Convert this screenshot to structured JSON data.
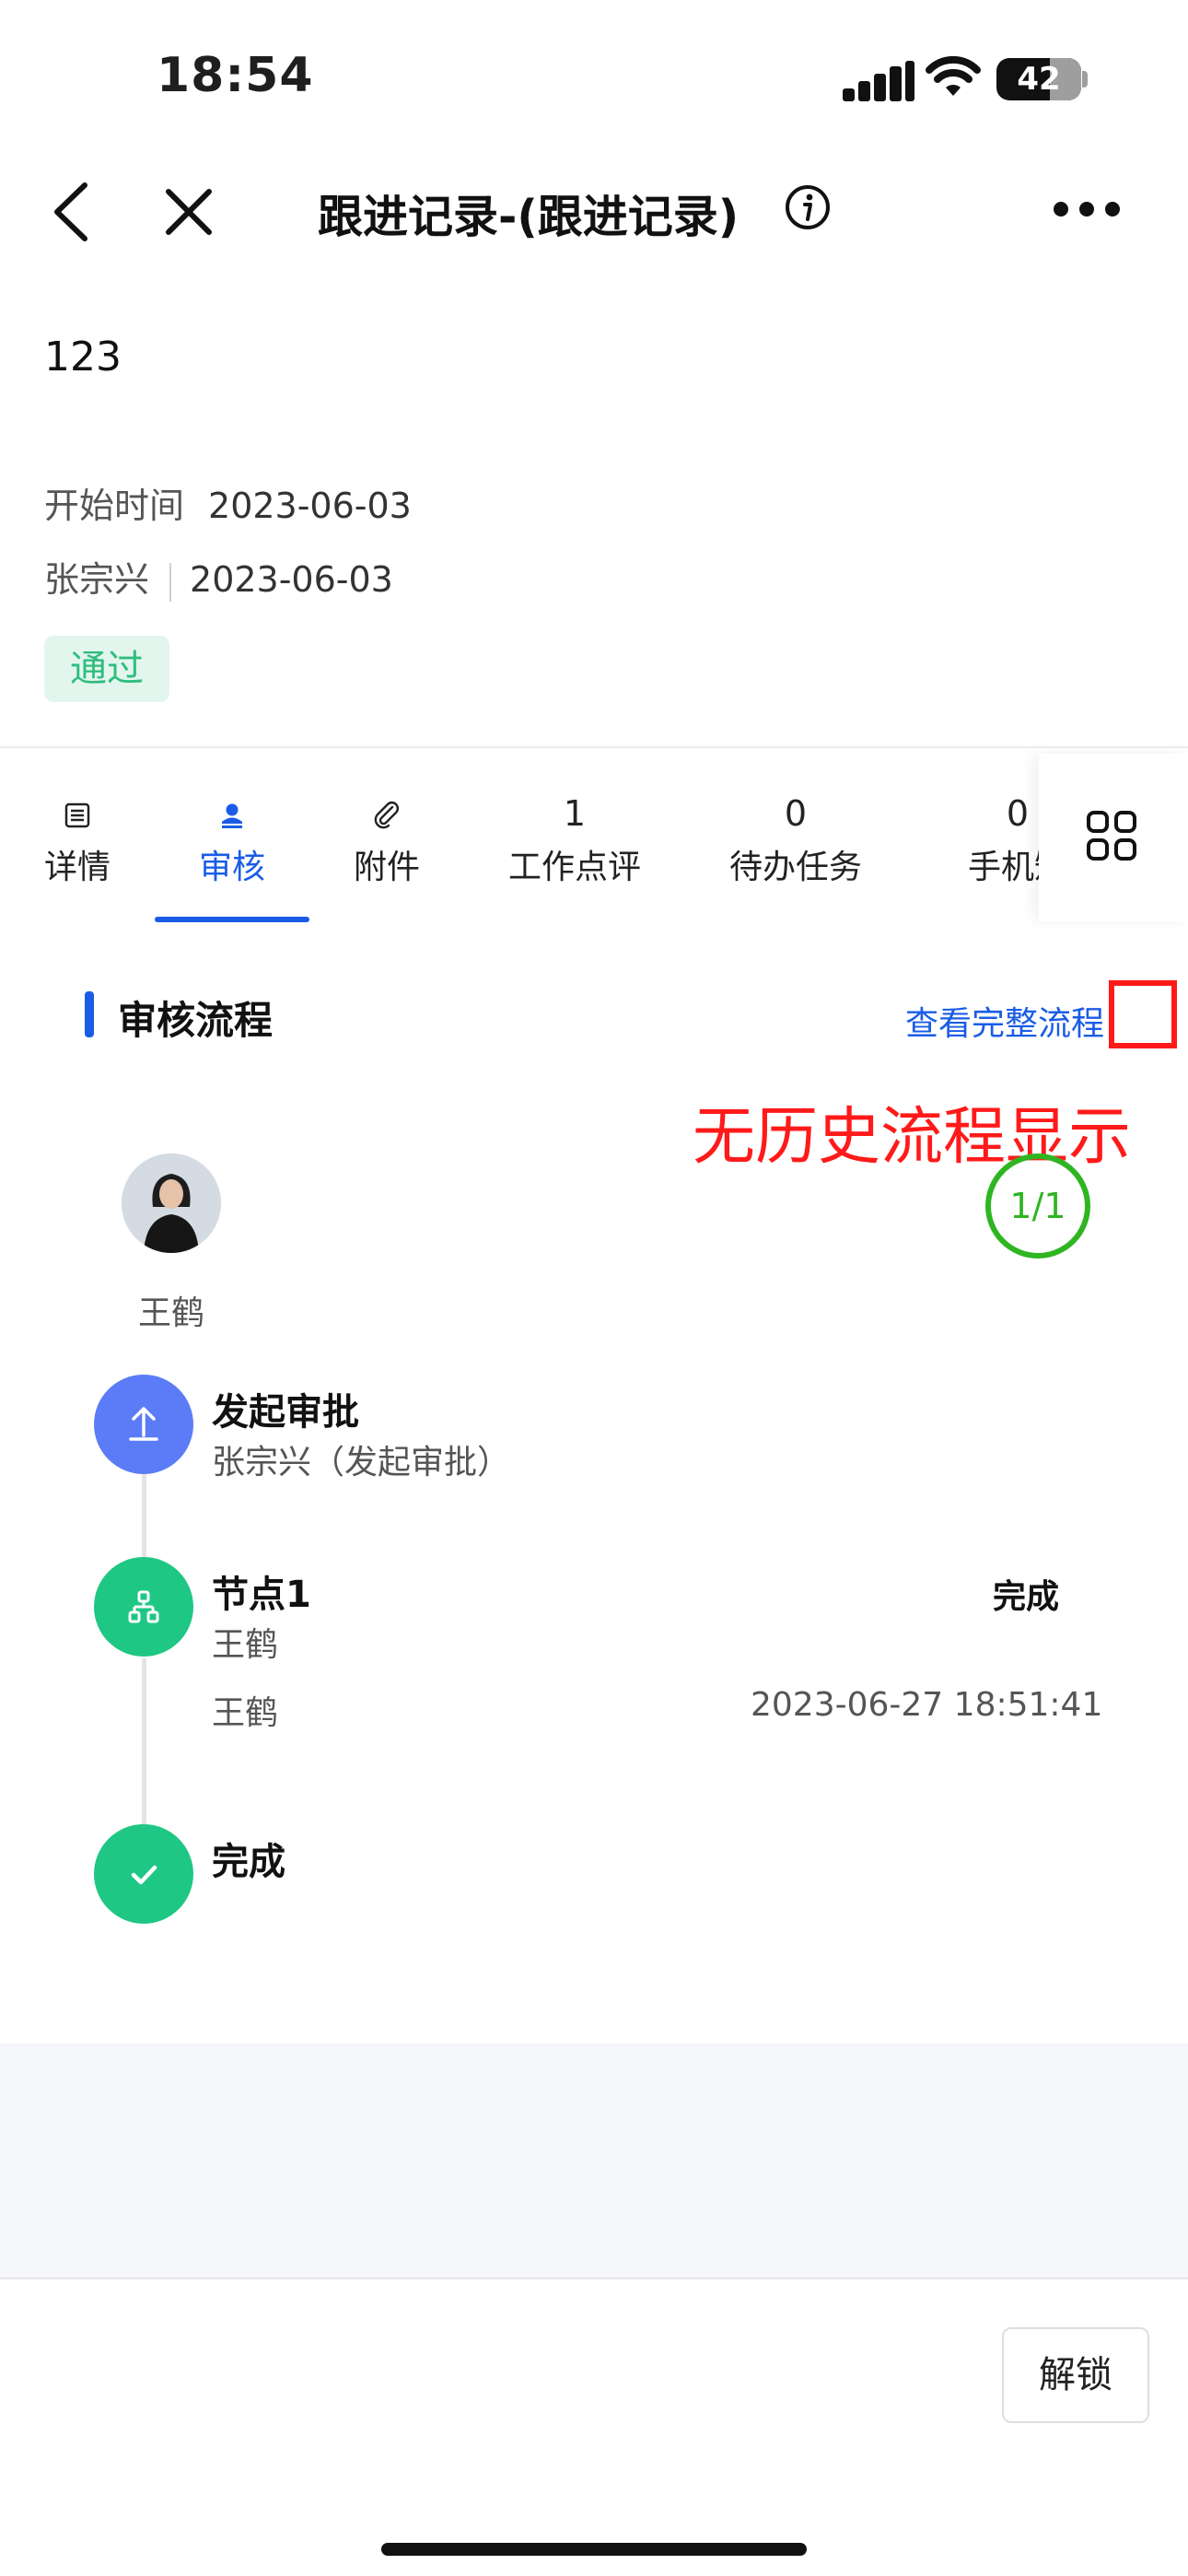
{
  "status_bar": {
    "time": "18:54",
    "battery": "42"
  },
  "nav": {
    "title": "跟进记录-(跟进记录)"
  },
  "record": {
    "title": "123",
    "start_label": "开始时间",
    "start_value": "2023-06-03",
    "creator": "张宗兴",
    "created_date": "2023-06-03",
    "status_badge": "通过"
  },
  "tabs": [
    {
      "label": "详情",
      "icon": "list-icon"
    },
    {
      "label": "审核",
      "icon": "person-icon",
      "active": true
    },
    {
      "label": "附件",
      "icon": "paperclip-icon"
    },
    {
      "label": "工作点评",
      "count": "1"
    },
    {
      "label": "待办任务",
      "count": "0"
    },
    {
      "label": "手机短",
      "count": "0"
    }
  ],
  "flow": {
    "section_title": "审核流程",
    "view_full_link": "查看完整流程",
    "annotation": "无历史流程显示",
    "page_indicator": "1/1",
    "approver_name": "王鹤",
    "steps": [
      {
        "title": "发起审批",
        "subtitle": "张宗兴（发起审批）",
        "color": "#5b7cf6",
        "icon": "upload-icon"
      },
      {
        "title": "节点1",
        "subtitle": "王鹤",
        "status": "完成",
        "operator": "王鹤",
        "time": "2023-06-27 18:51:41",
        "color": "#1fc784",
        "icon": "org-chart-icon"
      },
      {
        "title": "完成",
        "color": "#1fc784",
        "icon": "check-icon"
      }
    ]
  },
  "footer": {
    "unlock_label": "解锁"
  }
}
